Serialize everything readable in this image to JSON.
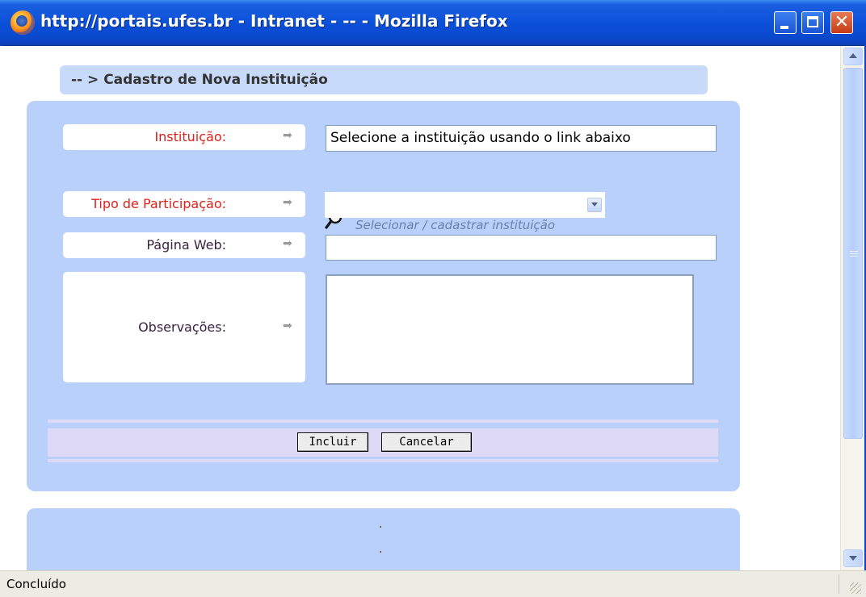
{
  "window": {
    "title": "http://portais.ufes.br - Intranet - -- - Mozilla Firefox"
  },
  "page": {
    "heading": "-- > Cadastro de Nova Instituição"
  },
  "form": {
    "instituicao": {
      "label": "Instituição:",
      "value": "Selecione a instituição usando o link abaixo",
      "link_text": "Selecionar / cadastrar instituição"
    },
    "tipo_participacao": {
      "label": "Tipo de Participação:",
      "selected": ""
    },
    "pagina_web": {
      "label": "Página Web:",
      "value": ""
    },
    "observacoes": {
      "label": "Observações:",
      "value": ""
    },
    "buttons": {
      "incluir": "Incluir",
      "cancelar": "Cancelar"
    }
  },
  "statusbar": {
    "text": "Concluído"
  },
  "colors": {
    "required_label": "#e0201a",
    "optional_label": "#3a2240",
    "panel": "#b9d1fa",
    "header_bar": "#c8dafa",
    "titlebar": "#0a4fd8"
  },
  "icons": [
    "firefox-icon",
    "minimize-icon",
    "maximize-icon",
    "close-icon",
    "arrow-right-icon",
    "magnifier-icon",
    "chevron-down-icon",
    "scroll-up-icon",
    "scroll-down-icon",
    "resize-grip-icon"
  ]
}
